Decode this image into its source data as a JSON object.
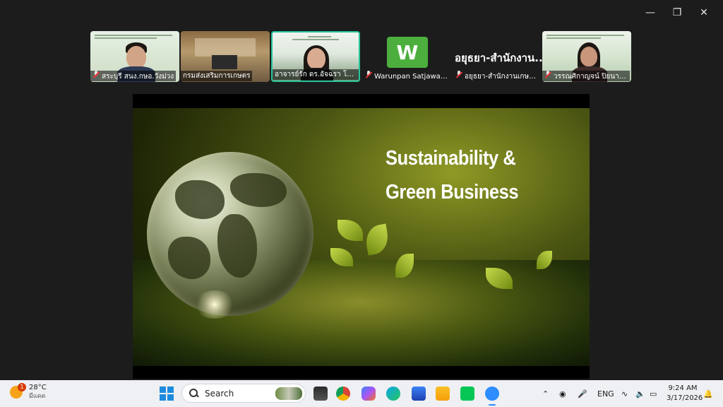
{
  "window": {
    "minimize_icon": "minimize-icon",
    "restore_icon": "restore-icon",
    "close_icon": "close-icon"
  },
  "participants": [
    {
      "name": "สระบุรี สนง.กษอ.วังม่วง",
      "muted": true
    },
    {
      "name": "กรมส่งเสริมการเกษตร",
      "muted": false
    },
    {
      "name": "อาจารย์รัก ดร.อัจฉรา โยมสินธุ์",
      "muted": false,
      "active_speaker": true
    },
    {
      "name": "Warunpan Satjawanit",
      "muted": true,
      "avatar_letter": "W",
      "avatar_color": "#4caf3d"
    },
    {
      "name": "อยุธยา-สำนักงานเกษตรอำ...",
      "muted": true,
      "display_title": "อยุธยา-สำนักงาน..."
    },
    {
      "name": "วรรณศิกาญจน์ ปิยนาท ส...",
      "muted": true
    }
  ],
  "slide": {
    "title_line1": "Sustainability &",
    "title_line2": "Green Business"
  },
  "taskbar": {
    "weather_temp": "28°C",
    "weather_desc": "มีแดด",
    "weather_badge": "1",
    "search_placeholder": "Search",
    "apps": [
      "file-explorer-taskview",
      "chrome",
      "copilot",
      "edge",
      "microsoft-store",
      "file-explorer",
      "line",
      "zoom"
    ],
    "language": "ENG",
    "time": "9:24 AM",
    "date": "3/17/2026"
  }
}
